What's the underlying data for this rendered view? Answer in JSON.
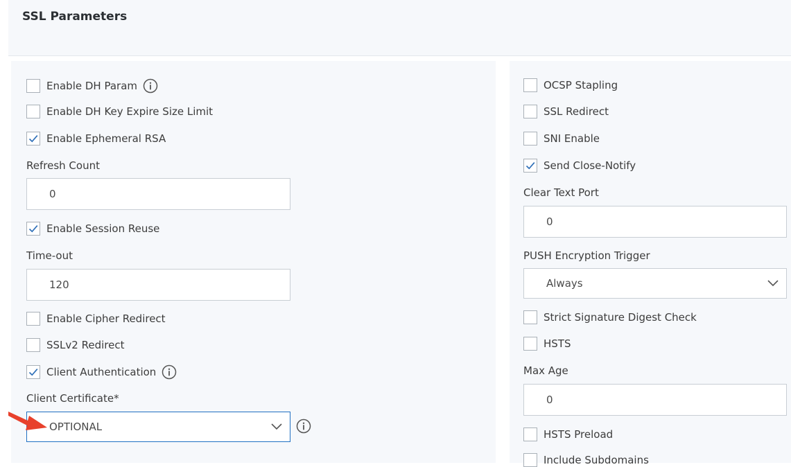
{
  "header": {
    "title": "SSL Parameters"
  },
  "left": {
    "enable_dh_param": {
      "label": "Enable DH Param",
      "checked": false
    },
    "enable_dh_key_expire": {
      "label": "Enable DH Key Expire Size Limit",
      "checked": false
    },
    "enable_ephemeral_rsa": {
      "label": "Enable Ephemeral RSA",
      "checked": true
    },
    "refresh_count": {
      "label": "Refresh Count",
      "value": "0"
    },
    "enable_session_reuse": {
      "label": "Enable Session Reuse",
      "checked": true
    },
    "timeout": {
      "label": "Time-out",
      "value": "120"
    },
    "enable_cipher_redirect": {
      "label": "Enable Cipher Redirect",
      "checked": false
    },
    "sslv2_redirect": {
      "label": "SSLv2 Redirect",
      "checked": false
    },
    "client_authentication": {
      "label": "Client Authentication",
      "checked": true
    },
    "client_certificate": {
      "label": "Client Certificate*",
      "value": "OPTIONAL"
    }
  },
  "right": {
    "ocsp_stapling": {
      "label": "OCSP Stapling",
      "checked": false
    },
    "ssl_redirect": {
      "label": "SSL Redirect",
      "checked": false
    },
    "sni_enable": {
      "label": "SNI Enable",
      "checked": false
    },
    "send_close_notify": {
      "label": "Send Close-Notify",
      "checked": true
    },
    "clear_text_port": {
      "label": "Clear Text Port",
      "value": "0"
    },
    "push_encryption_trigger": {
      "label": "PUSH Encryption Trigger",
      "value": "Always"
    },
    "strict_signature_digest_check": {
      "label": "Strict Signature Digest Check",
      "checked": false
    },
    "hsts": {
      "label": "HSTS",
      "checked": false
    },
    "max_age": {
      "label": "Max Age",
      "value": "0"
    },
    "hsts_preload": {
      "label": "HSTS Preload",
      "checked": false
    },
    "include_subdomains": {
      "label": "Include Subdomains",
      "checked": false
    }
  },
  "colors": {
    "panel_bg": "#f6f8fb",
    "border": "#c8ced4",
    "accent_border": "#1f6fc2",
    "pointer_arrow": "#e8412c"
  },
  "icons": {
    "info": "info-circle-icon",
    "check": "checkmark-icon",
    "chevron": "chevron-down-icon",
    "pointer": "red-arrow-pointer"
  }
}
